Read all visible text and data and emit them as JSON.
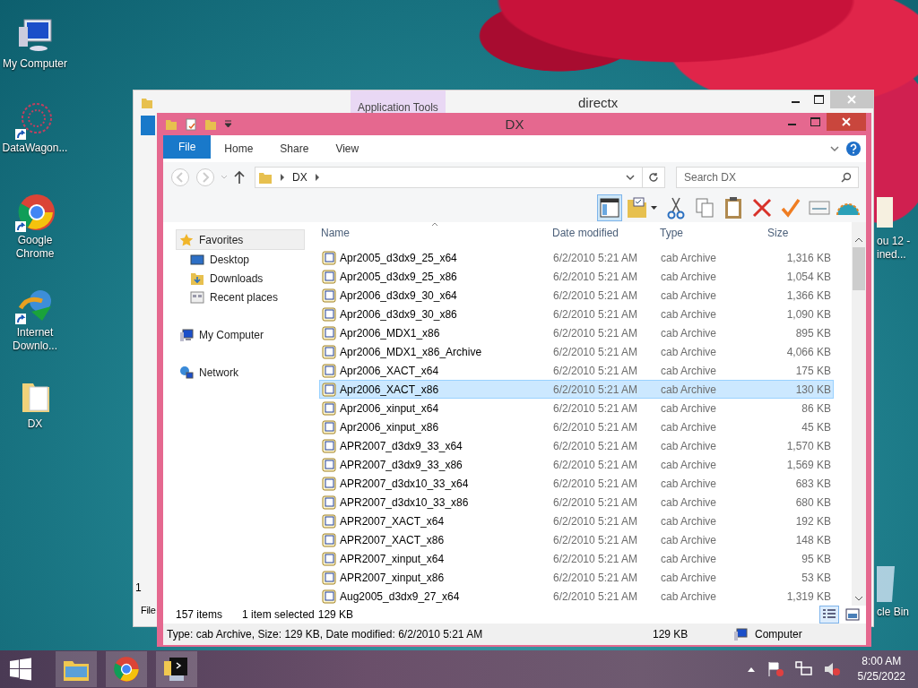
{
  "desktop": {
    "icons": [
      {
        "label": "My Computer",
        "kind": "computer",
        "shortcut": false
      },
      {
        "label": "DataWagon...",
        "kind": "network-art",
        "shortcut": true
      },
      {
        "label": "Google Chrome",
        "kind": "chrome",
        "shortcut": true
      },
      {
        "label": "Internet Downlo...",
        "kind": "downloader",
        "shortcut": true
      },
      {
        "label": "DX",
        "kind": "folder",
        "shortcut": false
      }
    ],
    "partial_icons": [
      {
        "label": "ou 12 -\nined...",
        "kind": "folder"
      },
      {
        "label": "cle Bin",
        "kind": "recycle"
      }
    ]
  },
  "back_window": {
    "title": "directx",
    "context_tab": "Application Tools",
    "status_fragment": "1",
    "left_text": "File"
  },
  "window": {
    "title": "DX",
    "ribbon_tabs": [
      {
        "label": "File",
        "kind": "menu"
      },
      {
        "label": "Home",
        "kind": "tab"
      },
      {
        "label": "Share",
        "kind": "tab"
      },
      {
        "label": "View",
        "kind": "tab"
      }
    ],
    "address": {
      "crumbs": [
        "DX"
      ]
    },
    "search": {
      "placeholder": "Search DX"
    },
    "toolbar": [
      {
        "kind": "pane",
        "selected": true
      },
      {
        "kind": "folder-check",
        "selected": false
      },
      {
        "kind": "scissors",
        "selected": false
      },
      {
        "kind": "copy",
        "selected": false
      },
      {
        "kind": "paste",
        "selected": false
      },
      {
        "kind": "delete",
        "selected": false
      },
      {
        "kind": "check",
        "selected": false
      },
      {
        "kind": "card",
        "selected": false
      },
      {
        "kind": "shell",
        "selected": false
      }
    ],
    "nav": [
      {
        "label": "Favorites",
        "kind": "star",
        "highlighted": true,
        "children": [
          {
            "label": "Desktop",
            "kind": "desktop",
            "highlighted": false
          },
          {
            "label": "Downloads",
            "kind": "downloads",
            "highlighted": false
          },
          {
            "label": "Recent places",
            "kind": "recent",
            "highlighted": false
          }
        ]
      },
      {
        "label": "My Computer",
        "kind": "computer",
        "highlighted": false
      },
      {
        "label": "Network",
        "kind": "network",
        "highlighted": false
      }
    ],
    "columns": [
      "Name",
      "Date modified",
      "Type",
      "Size"
    ],
    "rows": [
      {
        "name": "Apr2005_d3dx9_25_x64",
        "date": "6/2/2010 5:21 AM",
        "type": "cab Archive",
        "size": "1,316 KB",
        "selected": false
      },
      {
        "name": "Apr2005_d3dx9_25_x86",
        "date": "6/2/2010 5:21 AM",
        "type": "cab Archive",
        "size": "1,054 KB",
        "selected": false
      },
      {
        "name": "Apr2006_d3dx9_30_x64",
        "date": "6/2/2010 5:21 AM",
        "type": "cab Archive",
        "size": "1,366 KB",
        "selected": false
      },
      {
        "name": "Apr2006_d3dx9_30_x86",
        "date": "6/2/2010 5:21 AM",
        "type": "cab Archive",
        "size": "1,090 KB",
        "selected": false
      },
      {
        "name": "Apr2006_MDX1_x86",
        "date": "6/2/2010 5:21 AM",
        "type": "cab Archive",
        "size": "895 KB",
        "selected": false
      },
      {
        "name": "Apr2006_MDX1_x86_Archive",
        "date": "6/2/2010 5:21 AM",
        "type": "cab Archive",
        "size": "4,066 KB",
        "selected": false
      },
      {
        "name": "Apr2006_XACT_x64",
        "date": "6/2/2010 5:21 AM",
        "type": "cab Archive",
        "size": "175 KB",
        "selected": false
      },
      {
        "name": "Apr2006_XACT_x86",
        "date": "6/2/2010 5:21 AM",
        "type": "cab Archive",
        "size": "130 KB",
        "selected": true
      },
      {
        "name": "Apr2006_xinput_x64",
        "date": "6/2/2010 5:21 AM",
        "type": "cab Archive",
        "size": "86 KB",
        "selected": false
      },
      {
        "name": "Apr2006_xinput_x86",
        "date": "6/2/2010 5:21 AM",
        "type": "cab Archive",
        "size": "45 KB",
        "selected": false
      },
      {
        "name": "APR2007_d3dx9_33_x64",
        "date": "6/2/2010 5:21 AM",
        "type": "cab Archive",
        "size": "1,570 KB",
        "selected": false
      },
      {
        "name": "APR2007_d3dx9_33_x86",
        "date": "6/2/2010 5:21 AM",
        "type": "cab Archive",
        "size": "1,569 KB",
        "selected": false
      },
      {
        "name": "APR2007_d3dx10_33_x64",
        "date": "6/2/2010 5:21 AM",
        "type": "cab Archive",
        "size": "683 KB",
        "selected": false
      },
      {
        "name": "APR2007_d3dx10_33_x86",
        "date": "6/2/2010 5:21 AM",
        "type": "cab Archive",
        "size": "680 KB",
        "selected": false
      },
      {
        "name": "APR2007_XACT_x64",
        "date": "6/2/2010 5:21 AM",
        "type": "cab Archive",
        "size": "192 KB",
        "selected": false
      },
      {
        "name": "APR2007_XACT_x86",
        "date": "6/2/2010 5:21 AM",
        "type": "cab Archive",
        "size": "148 KB",
        "selected": false
      },
      {
        "name": "APR2007_xinput_x64",
        "date": "6/2/2010 5:21 AM",
        "type": "cab Archive",
        "size": "95 KB",
        "selected": false
      },
      {
        "name": "APR2007_xinput_x86",
        "date": "6/2/2010 5:21 AM",
        "type": "cab Archive",
        "size": "53 KB",
        "selected": false
      },
      {
        "name": "Aug2005_d3dx9_27_x64",
        "date": "6/2/2010 5:21 AM",
        "type": "cab Archive",
        "size": "1,319 KB",
        "selected": false
      }
    ],
    "status": {
      "count": "157 items",
      "selection": "1 item selected",
      "selection_size": "129 KB"
    },
    "view_buttons": [
      {
        "kind": "details",
        "selected": true
      },
      {
        "kind": "large-icons",
        "selected": false
      }
    ],
    "details_bar": {
      "text": "Type: cab Archive, Size: 129 KB, Date modified: 6/2/2010 5:21 AM",
      "size": "129 KB",
      "zone": "Computer"
    }
  },
  "taskbar": {
    "apps": [
      {
        "kind": "explorer"
      },
      {
        "kind": "chrome"
      },
      {
        "kind": "terminal"
      }
    ],
    "time": "8:00 AM",
    "date": "5/25/2022"
  }
}
